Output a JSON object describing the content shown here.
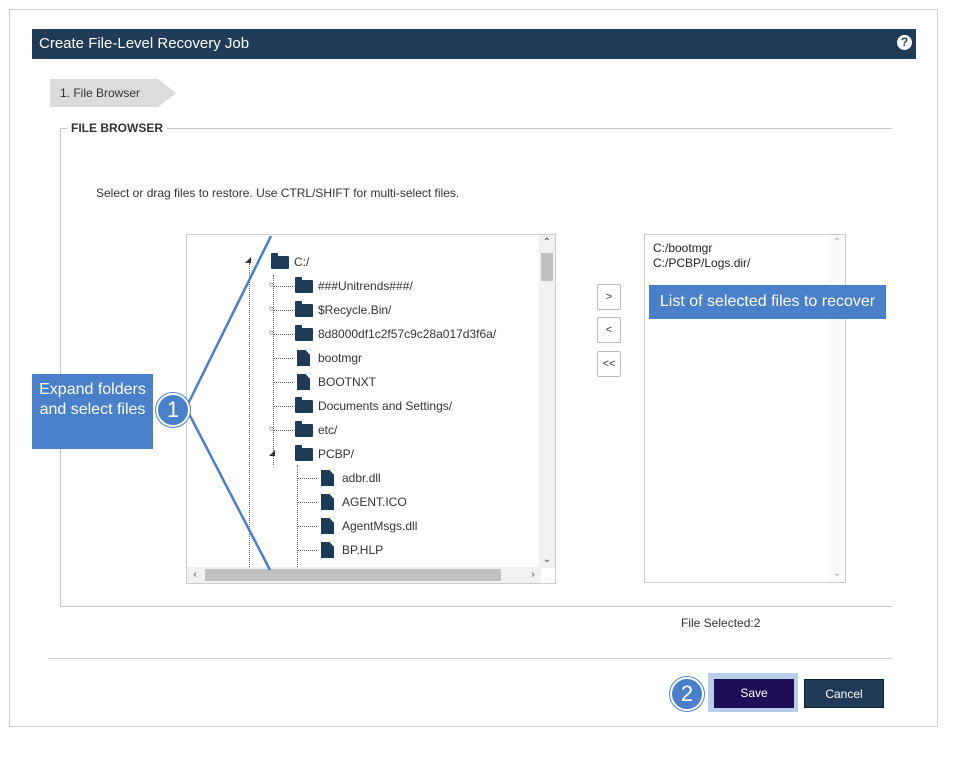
{
  "dialog": {
    "title": "Create File-Level Recovery Job",
    "help_icon": "?"
  },
  "steps": [
    {
      "label": "1. File Browser"
    }
  ],
  "file_browser": {
    "legend": "FILE BROWSER",
    "instructions": "Select or drag files to restore. Use CTRL/SHIFT for multi-select files.",
    "tree": [
      {
        "label": "C:/",
        "type": "folder",
        "expanded": true
      },
      {
        "label": "###Unitrends###/",
        "type": "folder"
      },
      {
        "label": "$Recycle.Bin/",
        "type": "folder"
      },
      {
        "label": "8d8000df1c2f57c9c28a017d3f6a/",
        "type": "folder"
      },
      {
        "label": "bootmgr",
        "type": "file"
      },
      {
        "label": "BOOTNXT",
        "type": "file"
      },
      {
        "label": "Documents and Settings/",
        "type": "folder"
      },
      {
        "label": "etc/",
        "type": "folder"
      },
      {
        "label": "PCBP/",
        "type": "folder",
        "expanded": true
      },
      {
        "label": "adbr.dll",
        "type": "file"
      },
      {
        "label": "AGENT.ICO",
        "type": "file"
      },
      {
        "label": "AgentMsgs.dll",
        "type": "file"
      },
      {
        "label": "BP.HLP",
        "type": "file"
      }
    ],
    "move_buttons": {
      "add": ">",
      "remove": "<",
      "remove_all": "<<"
    },
    "selected": [
      "C:/bootmgr",
      "C:/PCBP/Logs.dir/"
    ],
    "file_selected_text": "File Selected:2"
  },
  "callouts": {
    "expand": "Expand folders and select files",
    "selected_list": "List of selected files to recover",
    "step1": "1",
    "step2": "2"
  },
  "footer": {
    "save_label": "Save",
    "cancel_label": "Cancel"
  },
  "colors": {
    "header": "#1f3b57",
    "callout": "#4a7fc9",
    "save": "#1e0d57"
  }
}
